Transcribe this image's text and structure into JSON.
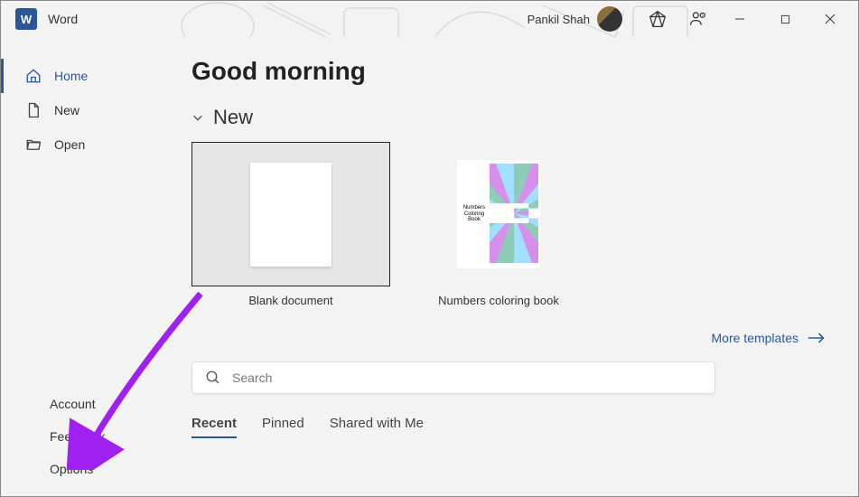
{
  "titlebar": {
    "app_name": "Word",
    "user": "Pankil Shah"
  },
  "sidebar": {
    "items": [
      {
        "label": "Home"
      },
      {
        "label": "New"
      },
      {
        "label": "Open"
      }
    ],
    "bottom": [
      {
        "label": "Account"
      },
      {
        "label": "Feedback"
      },
      {
        "label": "Options"
      }
    ]
  },
  "content": {
    "greeting": "Good morning",
    "new_section": "New",
    "templates": [
      {
        "label": "Blank document"
      },
      {
        "label": "Numbers coloring book",
        "preview_text": "Numbers Coloring Book"
      }
    ],
    "more_link": "More templates",
    "search_placeholder": "Search",
    "tabs": [
      {
        "label": "Recent"
      },
      {
        "label": "Pinned"
      },
      {
        "label": "Shared with Me"
      }
    ]
  }
}
